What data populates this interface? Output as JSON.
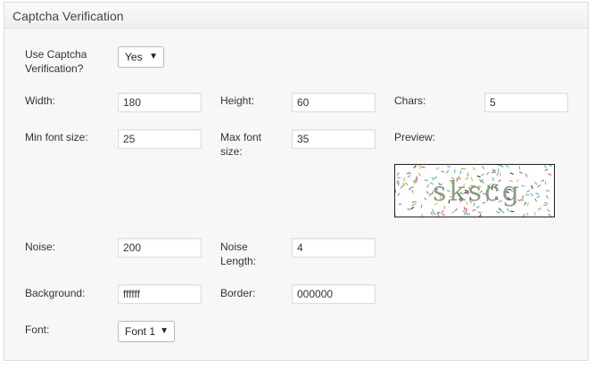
{
  "section": {
    "title": "Captcha Verification"
  },
  "use_captcha": {
    "label": "Use Captcha Verification?",
    "value": "Yes"
  },
  "width": {
    "label": "Width:",
    "value": "180"
  },
  "height": {
    "label": "Height:",
    "value": "60"
  },
  "chars": {
    "label": "Chars:",
    "value": "5"
  },
  "min_font_size": {
    "label": "Min font size:",
    "value": "25"
  },
  "max_font_size": {
    "label": "Max font size:",
    "value": "35"
  },
  "preview": {
    "label": "Preview:",
    "captcha_text": "skscg"
  },
  "noise": {
    "label": "Noise:",
    "value": "200"
  },
  "noise_length": {
    "label": "Noise Length:",
    "value": "4"
  },
  "background": {
    "label": "Background:",
    "value": "ffffff"
  },
  "border": {
    "label": "Border:",
    "value": "000000"
  },
  "font": {
    "label": "Font:",
    "value": "Font 1"
  },
  "icons": {
    "select_arrow": "dropdown-arrow-icon"
  }
}
